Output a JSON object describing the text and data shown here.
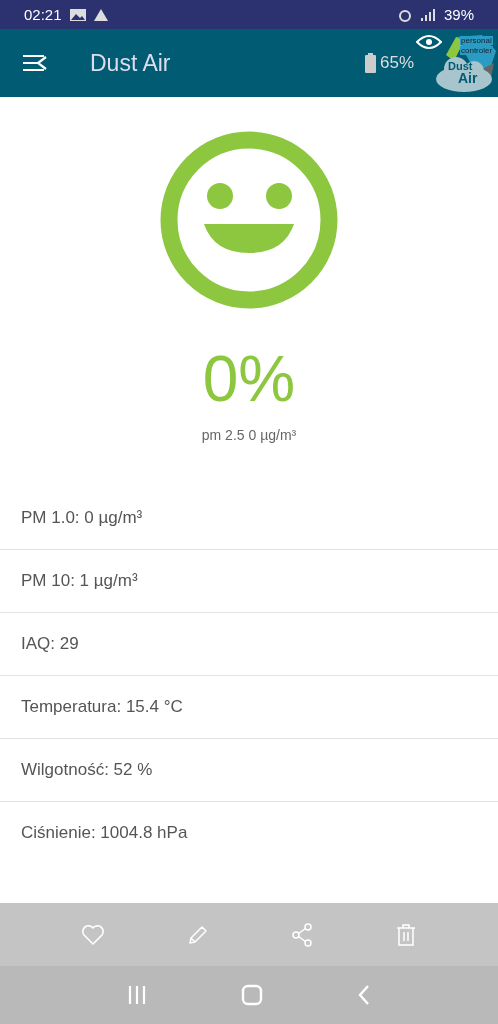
{
  "status_bar": {
    "time": "02:21",
    "battery": "39%"
  },
  "app_bar": {
    "title": "Dust Air",
    "device_battery": "65%",
    "logo": {
      "small_line_1": "personal",
      "small_line_2": "controler",
      "line_1": "Dust",
      "line_2": "Air"
    }
  },
  "gauge": {
    "percent": "0%",
    "reading": "pm 2.5 0 µg/m³"
  },
  "measurements": [
    {
      "text": "PM 1.0: 0 µg/m³"
    },
    {
      "text": "PM 10: 1 µg/m³"
    },
    {
      "text": "IAQ: 29"
    },
    {
      "text": "Temperatura: 15.4 °C"
    },
    {
      "text": "Wilgotność: 52 %"
    },
    {
      "text": "Ciśnienie: 1004.8 hPa"
    }
  ],
  "actions": [
    {
      "kind": "favorite"
    },
    {
      "kind": "edit"
    },
    {
      "kind": "share"
    },
    {
      "kind": "delete"
    }
  ],
  "nav": [
    {
      "kind": "recents"
    },
    {
      "kind": "home"
    },
    {
      "kind": "back"
    }
  ]
}
